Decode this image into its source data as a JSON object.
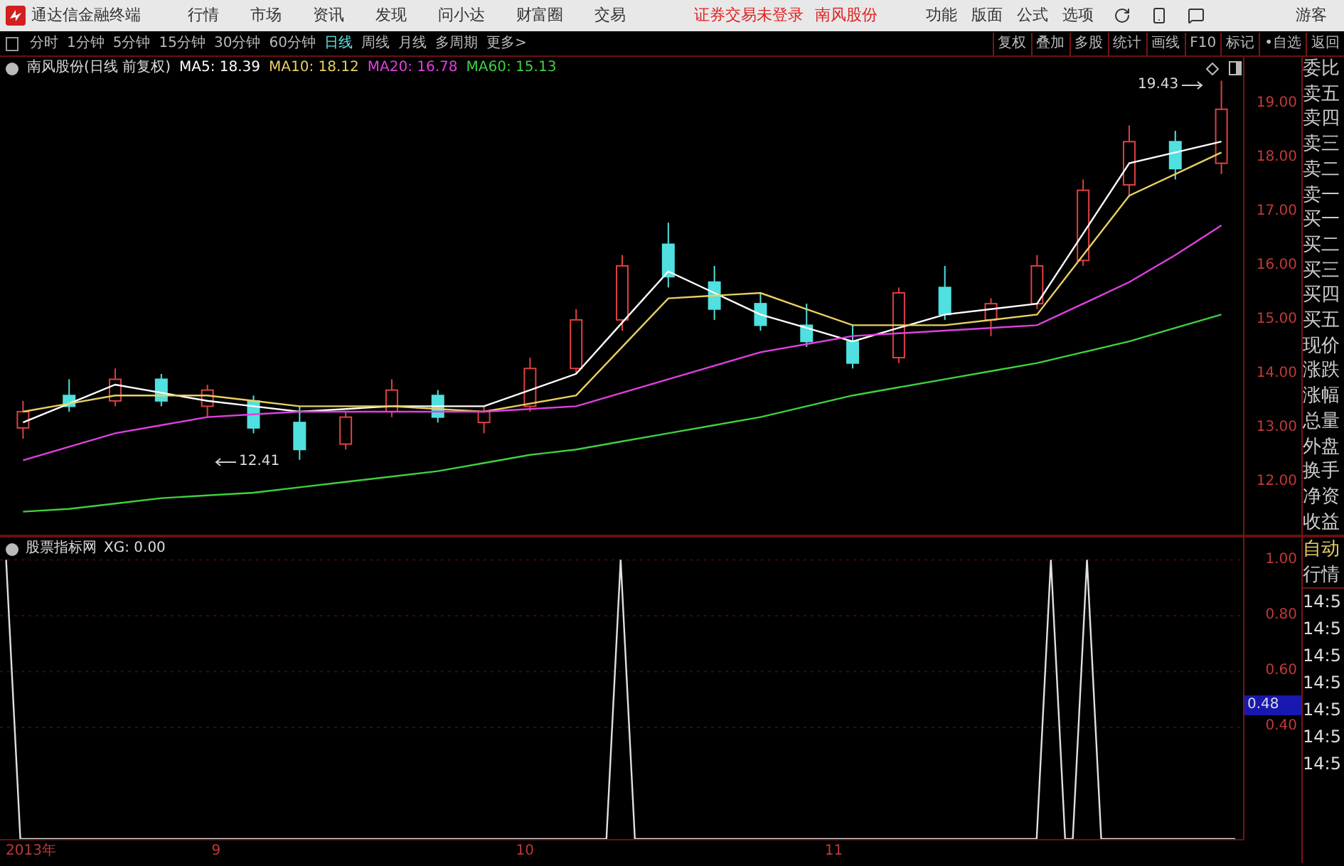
{
  "top_bar": {
    "app_title": "通达信金融终端",
    "menus": [
      "行情",
      "市场",
      "资讯",
      "发现",
      "问小达",
      "财富圈",
      "交易"
    ],
    "status": "证券交易未登录",
    "stock": "南风股份",
    "tools": [
      "功能",
      "版面",
      "公式",
      "选项"
    ],
    "user": "游客"
  },
  "toolbar": {
    "periods": [
      {
        "label": "分时",
        "selected": false
      },
      {
        "label": "1分钟",
        "selected": false
      },
      {
        "label": "5分钟",
        "selected": false
      },
      {
        "label": "15分钟",
        "selected": false
      },
      {
        "label": "30分钟",
        "selected": false
      },
      {
        "label": "60分钟",
        "selected": false
      },
      {
        "label": "日线",
        "selected": true
      },
      {
        "label": "周线",
        "selected": false
      },
      {
        "label": "月线",
        "selected": false
      },
      {
        "label": "多周期",
        "selected": false
      },
      {
        "label": "更多>",
        "selected": false
      }
    ],
    "actions": [
      "复权",
      "叠加",
      "多股",
      "统计",
      "画线",
      "F10",
      "标记",
      "•自选",
      "返回"
    ]
  },
  "main_chart": {
    "title": "南风股份(日线 前复权)",
    "legend_values": [
      ": 18.39",
      ": 18.12",
      ": 16.78",
      ": 15.13"
    ],
    "high_label": "19.43",
    "low_label": "12.41",
    "chart_data": {
      "type": "candlestick",
      "categories": [
        null,
        null,
        null,
        null,
        null,
        null,
        null,
        null,
        null,
        null,
        null,
        null,
        null,
        null,
        null,
        null,
        null,
        null,
        null,
        null,
        null,
        null,
        null,
        null,
        null,
        null,
        null
      ],
      "ylim": [
        10.97,
        19.87
      ],
      "ohlc": [
        [
          13.0,
          13.5,
          12.8,
          13.3
        ],
        [
          13.6,
          13.9,
          13.3,
          13.4
        ],
        [
          13.5,
          14.1,
          13.4,
          13.9
        ],
        [
          13.9,
          14.0,
          13.4,
          13.5
        ],
        [
          13.4,
          13.8,
          13.2,
          13.7
        ],
        [
          13.5,
          13.6,
          12.9,
          13.0
        ],
        [
          13.1,
          13.4,
          12.41,
          12.6
        ],
        [
          12.7,
          13.3,
          12.6,
          13.2
        ],
        [
          13.3,
          13.9,
          13.2,
          13.7
        ],
        [
          13.6,
          13.7,
          13.1,
          13.2
        ],
        [
          13.1,
          13.4,
          12.9,
          13.3
        ],
        [
          13.4,
          14.3,
          13.3,
          14.1
        ],
        [
          14.1,
          15.2,
          14.0,
          15.0
        ],
        [
          15.0,
          16.2,
          14.8,
          16.0
        ],
        [
          16.4,
          16.8,
          15.6,
          15.8
        ],
        [
          15.7,
          16.0,
          15.0,
          15.2
        ],
        [
          15.3,
          15.5,
          14.8,
          14.9
        ],
        [
          14.9,
          15.3,
          14.5,
          14.6
        ],
        [
          14.6,
          14.9,
          14.1,
          14.2
        ],
        [
          14.3,
          15.6,
          14.2,
          15.5
        ],
        [
          15.6,
          16.0,
          15.0,
          15.1
        ],
        [
          15.0,
          15.4,
          14.7,
          15.3
        ],
        [
          15.3,
          16.2,
          15.2,
          16.0
        ],
        [
          16.1,
          17.6,
          16.0,
          17.4
        ],
        [
          17.5,
          18.6,
          17.3,
          18.3
        ],
        [
          18.3,
          18.5,
          17.6,
          17.8
        ],
        [
          17.9,
          19.43,
          17.7,
          18.9
        ]
      ],
      "yticks": [
        {
          "value": 12,
          "label": "12.00"
        },
        {
          "value": 13,
          "label": "13.00"
        },
        {
          "value": 14,
          "label": "14.00"
        },
        {
          "value": 15,
          "label": "15.00"
        },
        {
          "value": 16,
          "label": "16.00"
        },
        {
          "value": 17,
          "label": "17.00"
        },
        {
          "value": 18,
          "label": "18.00"
        },
        {
          "value": 19,
          "label": "19.00"
        }
      ],
      "series": [
        {
          "name": "MA5",
          "type": "line",
          "color": "#ffffff",
          "values": [
            13.1,
            13.45,
            13.8,
            13.65,
            13.5,
            13.4,
            13.3,
            13.35,
            13.4,
            13.4,
            13.4,
            13.7,
            14.0,
            14.95,
            15.9,
            15.5,
            15.1,
            14.85,
            14.6,
            14.85,
            15.1,
            15.2,
            15.3,
            16.6,
            17.9,
            18.1,
            18.3
          ]
        },
        {
          "name": "MA10",
          "type": "line",
          "color": "#e8d060",
          "values": [
            13.3,
            13.45,
            13.6,
            13.6,
            13.6,
            13.5,
            13.4,
            13.4,
            13.4,
            13.35,
            13.3,
            13.45,
            13.6,
            14.5,
            15.4,
            15.45,
            15.5,
            15.2,
            14.9,
            14.9,
            14.9,
            15.0,
            15.1,
            16.2,
            17.3,
            17.7,
            18.1
          ]
        },
        {
          "name": "MA20",
          "type": "line",
          "color": "#e040e0",
          "values": [
            12.4,
            12.65,
            12.9,
            13.05,
            13.2,
            13.25,
            13.3,
            13.3,
            13.3,
            13.3,
            13.3,
            13.35,
            13.4,
            13.65,
            13.9,
            14.15,
            14.4,
            14.55,
            14.7,
            14.75,
            14.8,
            14.85,
            14.9,
            15.3,
            15.7,
            16.2,
            16.75
          ]
        },
        {
          "name": "MA60",
          "type": "line",
          "color": "#40d040",
          "values": [
            11.45,
            11.5,
            11.6,
            11.7,
            11.75,
            11.8,
            11.9,
            12.0,
            12.1,
            12.2,
            12.35,
            12.5,
            12.6,
            12.75,
            12.9,
            13.05,
            13.2,
            13.4,
            13.6,
            13.75,
            13.9,
            14.05,
            14.2,
            14.4,
            14.6,
            14.85,
            15.1
          ]
        }
      ]
    }
  },
  "indicator": {
    "title": "股票指标网",
    "reading": ": 0.00",
    "year_label": "2013年",
    "current_value": "0.48",
    "chart_data": {
      "type": "line",
      "x": [
        8.32,
        8.366,
        10.264,
        10.31,
        10.356,
        11.657,
        11.703,
        11.749,
        11.774,
        11.82,
        11.866,
        12.3
      ],
      "xlim": [
        8.3,
        12.33
      ],
      "ylim": [
        0,
        1.08
      ],
      "grid": true,
      "xticks": [
        {
          "value": 9,
          "label": "9"
        },
        {
          "value": 10,
          "label": "10"
        },
        {
          "value": 11,
          "label": "11"
        }
      ],
      "yticks": [
        {
          "value": 0.4,
          "label": "0.40"
        },
        {
          "value": 0.6,
          "label": "0.60"
        },
        {
          "value": 0.8,
          "label": "0.80"
        },
        {
          "value": 1,
          "label": "1.00"
        }
      ],
      "series": [
        {
          "name": "XG",
          "color": "#e0e0e0",
          "values": [
            1,
            0,
            0,
            1,
            0,
            0,
            1,
            0,
            0,
            1,
            0,
            0
          ]
        }
      ]
    }
  },
  "quote_panel": {
    "labels": [
      "委比",
      "卖五",
      "卖四",
      "卖三",
      "卖二",
      "卖一",
      "买一",
      "买二",
      "买三",
      "买四",
      "买五",
      "现价",
      "涨跌",
      "涨幅",
      "总量",
      "外盘",
      "换手",
      "净资",
      "收益"
    ],
    "tab": "自动",
    "tab2": "行情",
    "ticks": [
      "14:5",
      "14:5",
      "14:5",
      "14:5",
      "14:5",
      "14:5",
      "14:5"
    ]
  }
}
